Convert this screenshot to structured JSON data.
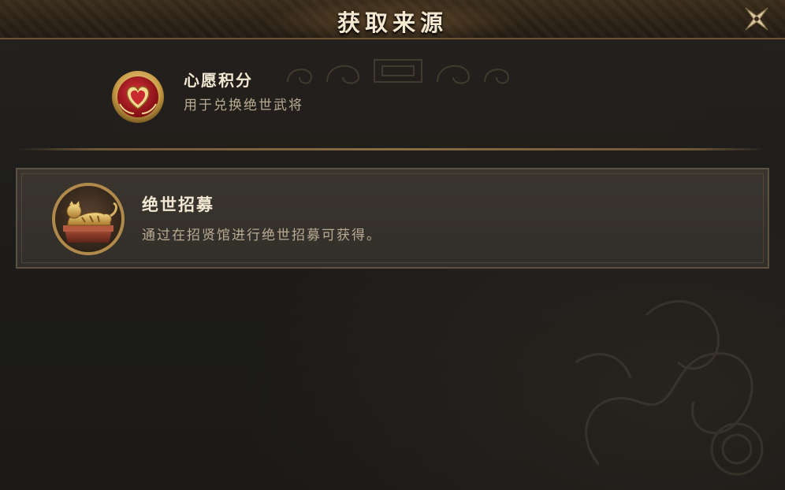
{
  "dialog": {
    "title": "获取来源",
    "close_icon": "close-x-icon"
  },
  "item": {
    "name": "心愿积分",
    "description": "用于兑换绝世武将",
    "icon": "heart-coin-icon"
  },
  "sources": [
    {
      "name": "绝世招募",
      "description": "通过在招贤馆进行绝世招募可获得。",
      "icon": "golden-tiger-seal-icon"
    }
  ],
  "colors": {
    "title_text": "#f4e9d0",
    "desc_text": "#b9ab93",
    "gold_accent": "#8a6c42"
  }
}
